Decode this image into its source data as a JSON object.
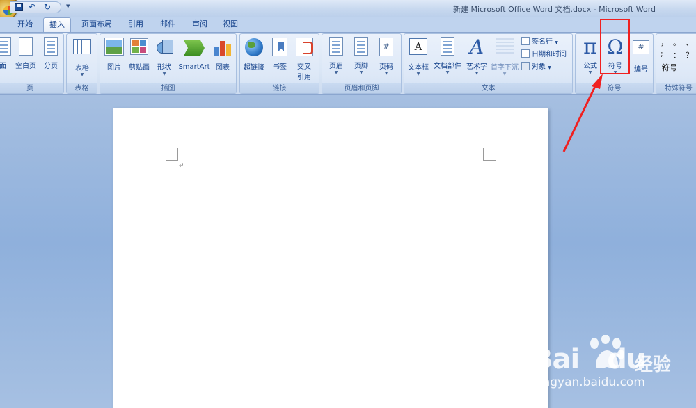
{
  "window": {
    "title": "新建 Microsoft Office Word 文档.docx - Microsoft Word"
  },
  "tabs": [
    {
      "label": "开始"
    },
    {
      "label": "插入",
      "active": true
    },
    {
      "label": "页面布局"
    },
    {
      "label": "引用"
    },
    {
      "label": "邮件"
    },
    {
      "label": "审阅"
    },
    {
      "label": "视图"
    }
  ],
  "ribbon": {
    "pages": {
      "label": "页",
      "cover": "面",
      "blank": "空白页",
      "break": "分页"
    },
    "tables": {
      "label": "表格",
      "table": "表格"
    },
    "illustrations": {
      "label": "插图",
      "picture": "图片",
      "clipart": "剪贴画",
      "shapes": "形状",
      "smartart": "SmartArt",
      "chart": "图表"
    },
    "links": {
      "label": "链接",
      "hyperlink": "超链接",
      "bookmark": "书签",
      "crossref_1": "交叉",
      "crossref_2": "引用"
    },
    "header_footer": {
      "label": "页眉和页脚",
      "header": "页眉",
      "footer": "页脚",
      "page_number": "页码"
    },
    "text": {
      "label": "文本",
      "textbox": "文本框",
      "quickparts": "文档部件",
      "wordart": "艺术字",
      "dropcap": "首字下沉",
      "signature": "签名行",
      "datetime": "日期和时间",
      "object": "对象"
    },
    "symbols": {
      "label": "符号",
      "equation": "公式",
      "symbol": "符号",
      "numbering": "编号"
    },
    "special": {
      "label": "特殊符号",
      "symbol": "符号",
      "glyphs": [
        "，",
        "。",
        "、",
        ";",
        "：",
        "？"
      ]
    }
  },
  "colors": {
    "highlight": "#f02020",
    "accent": "#15428b"
  },
  "watermark": {
    "brand": "Bai",
    "brand2": "du",
    "suffix": "经验",
    "url": "jingyan.baidu.com"
  }
}
